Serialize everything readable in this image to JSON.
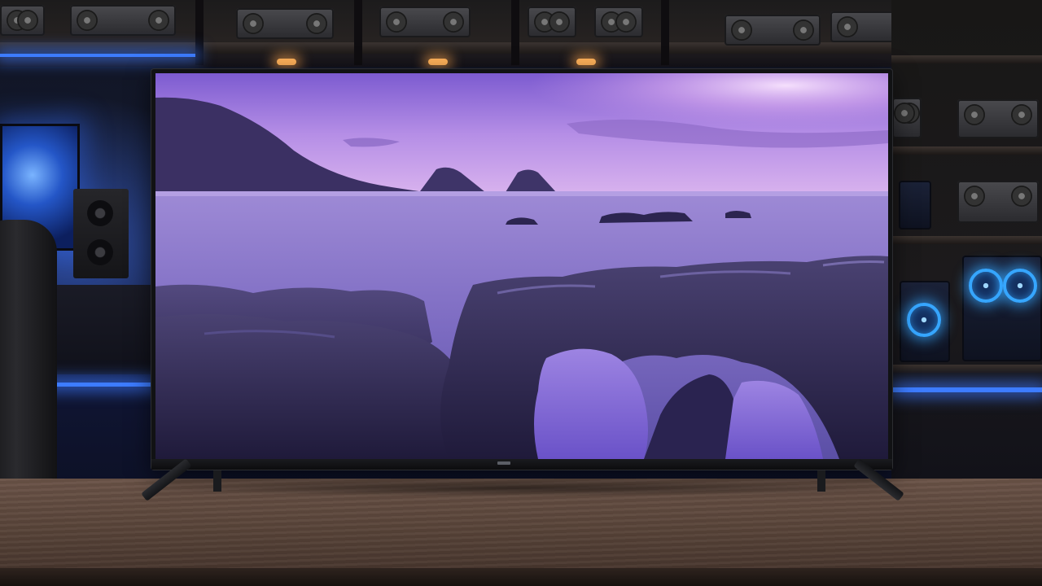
{
  "scene": {
    "subject": "flat-screen-tv",
    "screen_content": "purple-sunset-seascape",
    "colors": {
      "sky_top": "#8a6ad8",
      "sky_glow": "#e8b8f0",
      "water": "#7a6ab8",
      "rocks": "#2a2448",
      "ambient_blue": "#3d7cff",
      "warm_light": "#ffb25a",
      "table_wood": "#5b463b"
    }
  }
}
